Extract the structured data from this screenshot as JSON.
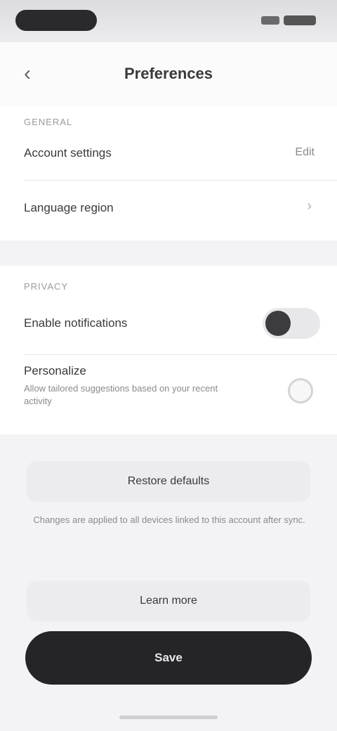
{
  "status_bar": {
    "icons": [
      "signal-icon",
      "battery-icon"
    ]
  },
  "header": {
    "back_icon": "‹",
    "title": "Preferences"
  },
  "section_one": {
    "label": "GENERAL",
    "rows": [
      {
        "label": "Account settings",
        "value": "Edit"
      },
      {
        "label": "Language region",
        "chevron": "›"
      }
    ]
  },
  "section_two": {
    "label": "PRIVACY",
    "toggle_row": {
      "label": "Enable notifications",
      "state": "on"
    },
    "option_row": {
      "label": "Personalize",
      "description": "Allow tailored suggestions based on your recent activity"
    }
  },
  "actions": {
    "secondary_button": "Restore defaults",
    "note": "Changes are applied to all devices linked to this account after sync.",
    "tertiary_button": "Learn more",
    "primary_button": "Save"
  }
}
